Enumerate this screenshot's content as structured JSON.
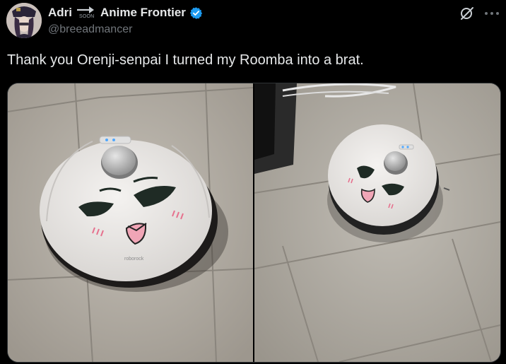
{
  "tweet": {
    "author_name": "Adri",
    "arrow_badge": "SOON",
    "author_name_suffix": "Anime Frontier",
    "handle": "@breeadmancer",
    "text": "Thank you Orenji-senpai I turned my Roomba into a brat.",
    "device_brand": "roborock"
  },
  "icons": {
    "verified": "verified-badge-icon",
    "grok": "grok-icon",
    "more": "more-icon"
  },
  "colors": {
    "background": "#000000",
    "text": "#e7e9ea",
    "secondary_text": "#71767b",
    "verified": "#1d9bf0"
  }
}
